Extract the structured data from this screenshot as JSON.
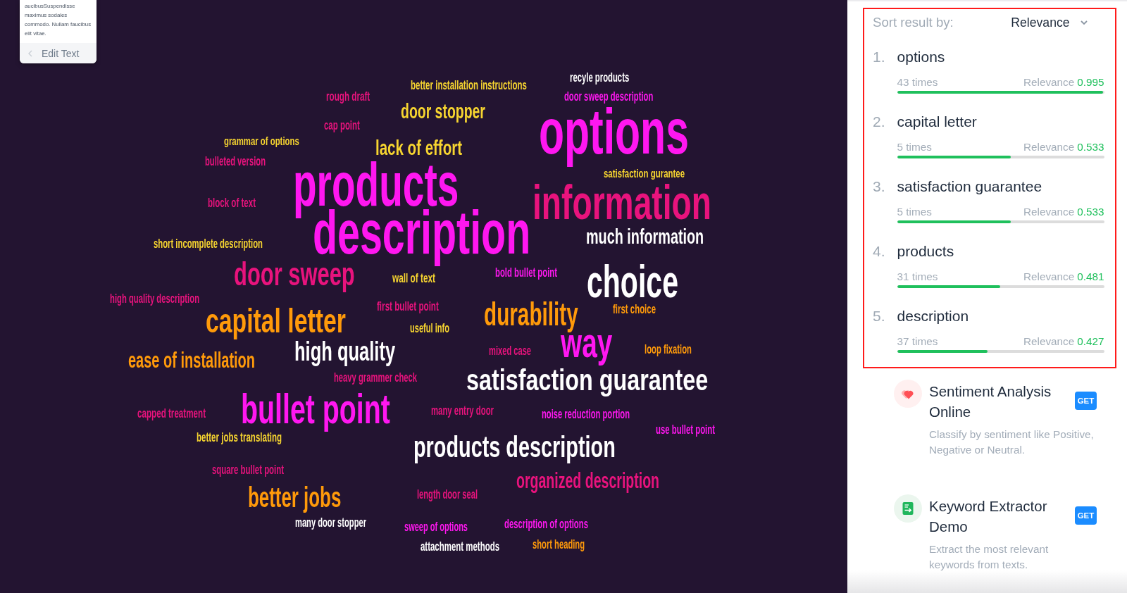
{
  "text_card": {
    "text": "aucibusSuspendisse maximus sodales commodo. Nullam faucibus elit vitae.",
    "edit_button": "Edit Text"
  },
  "word_cloud": {
    "words": [
      {
        "text": "recyle products",
        "color": "#ffffff"
      },
      {
        "text": "better installation instructions",
        "color": "#f7d530"
      },
      {
        "text": "rough draft",
        "color": "#e8137d"
      },
      {
        "text": "door sweep description",
        "color": "#ff17f0"
      },
      {
        "text": "door stopper",
        "color": "#f7d530"
      },
      {
        "text": "cap point",
        "color": "#e8137d"
      },
      {
        "text": "grammar of options",
        "color": "#f7d530"
      },
      {
        "text": "lack of effort",
        "color": "#f7d530"
      },
      {
        "text": "bulleted version",
        "color": "#e8137d"
      },
      {
        "text": "options",
        "color": "#ff17f0"
      },
      {
        "text": "satisfaction gurantee",
        "color": "#f7d530"
      },
      {
        "text": "block of text",
        "color": "#e8137d"
      },
      {
        "text": "products",
        "color": "#ff17f0"
      },
      {
        "text": "information",
        "color": "#e8137d"
      },
      {
        "text": "short incomplete description",
        "color": "#f7d530"
      },
      {
        "text": "description",
        "color": "#ff17f0"
      },
      {
        "text": "much information",
        "color": "#ffffff"
      },
      {
        "text": "door sweep",
        "color": "#e8137d"
      },
      {
        "text": "wall of text",
        "color": "#f7d530"
      },
      {
        "text": "bold bullet point",
        "color": "#ff17f0"
      },
      {
        "text": "high quality description",
        "color": "#e8137d"
      },
      {
        "text": "choice",
        "color": "#ffffff"
      },
      {
        "text": "capital letter",
        "color": "#ff9a0a"
      },
      {
        "text": "first bullet point",
        "color": "#e8137d"
      },
      {
        "text": "durability",
        "color": "#ff9a0a"
      },
      {
        "text": "first choice",
        "color": "#ff9a0a"
      },
      {
        "text": "useful info",
        "color": "#f7d530"
      },
      {
        "text": "ease of installation",
        "color": "#ff9a0a"
      },
      {
        "text": "high quality",
        "color": "#ffffff"
      },
      {
        "text": "mixed case",
        "color": "#e8137d"
      },
      {
        "text": "way",
        "color": "#ff17f0"
      },
      {
        "text": "loop fixation",
        "color": "#ff9a0a"
      },
      {
        "text": "heavy grammer check",
        "color": "#e8137d"
      },
      {
        "text": "satisfaction guarantee",
        "color": "#ffffff"
      },
      {
        "text": "capped treatment",
        "color": "#e8137d"
      },
      {
        "text": "bullet point",
        "color": "#ff17f0"
      },
      {
        "text": "many entry door",
        "color": "#e8137d"
      },
      {
        "text": "noise reduction portion",
        "color": "#ff17f0"
      },
      {
        "text": "use bullet point",
        "color": "#ff17f0"
      },
      {
        "text": "better jobs translating",
        "color": "#f7d530"
      },
      {
        "text": "products description",
        "color": "#ffffff"
      },
      {
        "text": "square bullet point",
        "color": "#e8137d"
      },
      {
        "text": "organized description",
        "color": "#e8137d"
      },
      {
        "text": "better jobs",
        "color": "#ff9a0a"
      },
      {
        "text": "length door seal",
        "color": "#e8137d"
      },
      {
        "text": "many door stopper",
        "color": "#ffffff"
      },
      {
        "text": "sweep of options",
        "color": "#ff17f0"
      },
      {
        "text": "description of options",
        "color": "#ff17f0"
      },
      {
        "text": "attachment methods",
        "color": "#ffffff"
      },
      {
        "text": "short heading",
        "color": "#ff9a0a"
      }
    ]
  },
  "results": {
    "sort_label": "Sort result by:",
    "sort_value": "Relevance",
    "keywords": [
      {
        "rank": "1.",
        "term": "options",
        "count": "43 times",
        "relevance_label": "Relevance",
        "relevance": "0.995",
        "level": 0.995
      },
      {
        "rank": "2.",
        "term": "capital letter",
        "count": "5 times",
        "relevance_label": "Relevance",
        "relevance": "0.533",
        "level": 0.548
      },
      {
        "rank": "3.",
        "term": "satisfaction guarantee",
        "count": "5 times",
        "relevance_label": "Relevance",
        "relevance": "0.533",
        "level": 0.548
      },
      {
        "rank": "4.",
        "term": "products",
        "count": "31 times",
        "relevance_label": "Relevance",
        "relevance": "0.481",
        "level": 0.497
      },
      {
        "rank": "5.",
        "term": "description",
        "count": "37 times",
        "relevance_label": "Relevance",
        "relevance": "0.427",
        "level": 0.437
      }
    ]
  },
  "apps": [
    {
      "kind": "sentiment",
      "title": "Sentiment Analysis Online",
      "button": "GET",
      "description": "Classify by sentiment like Positive, Negative or Neutral."
    },
    {
      "kind": "extractor",
      "title": "Keyword Extractor Demo",
      "button": "GET",
      "description": "Extract the most relevant keywords from texts."
    }
  ]
}
